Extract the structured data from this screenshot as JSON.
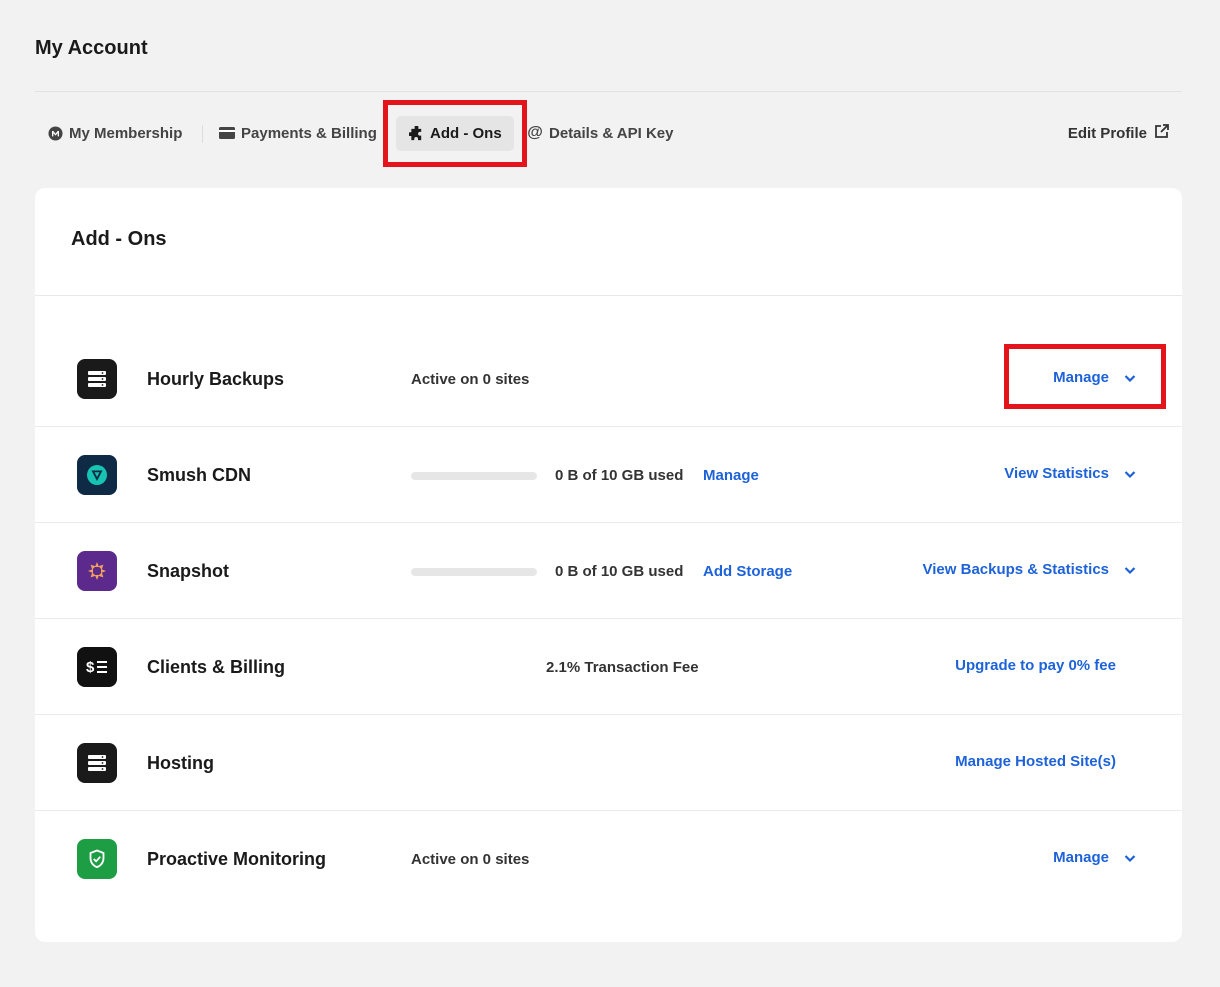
{
  "page": {
    "title": "My Account"
  },
  "tabs": [
    {
      "label": "My Membership",
      "icon": "membership-icon"
    },
    {
      "label": "Payments & Billing",
      "icon": "credit-card-icon"
    },
    {
      "label": "Add - Ons",
      "icon": "puzzle-icon",
      "active": true
    },
    {
      "label": "Details & API Key",
      "icon": "at-icon"
    }
  ],
  "edit_profile": {
    "label": "Edit Profile",
    "icon": "external-link-icon"
  },
  "card": {
    "title": "Add - Ons"
  },
  "addons": [
    {
      "name": "Hourly Backups",
      "status": "Active on 0 sites",
      "action": "Manage",
      "icon": "server-icon",
      "icon_bg": "#1a1a1a"
    },
    {
      "name": "Smush CDN",
      "usage": "0 B of 10 GB used",
      "usage_fraction": 0,
      "link": "Manage",
      "action": "View Statistics",
      "icon": "smush-cdn-icon",
      "icon_bg": "#0e2a44"
    },
    {
      "name": "Snapshot",
      "usage": "0 B of 10 GB used",
      "usage_fraction": 0,
      "link": "Add Storage",
      "action": "View Backups & Statistics",
      "icon": "snapshot-icon",
      "icon_bg": "#5b2a8c"
    },
    {
      "name": "Clients & Billing",
      "fee": "2.1% Transaction Fee",
      "action": "Upgrade to pay 0% fee",
      "icon": "dollar-list-icon",
      "icon_bg": "#111111"
    },
    {
      "name": "Hosting",
      "action": "Manage Hosted Site(s)",
      "icon": "server-icon",
      "icon_bg": "#1a1a1a"
    },
    {
      "name": "Proactive Monitoring",
      "status": "Active on 0 sites",
      "action": "Manage",
      "icon": "shield-check-icon",
      "icon_bg": "#1e9e44"
    }
  ],
  "colors": {
    "accent": "#1d62d8",
    "highlight": "#e3141b",
    "background": "#f2f2f2"
  }
}
